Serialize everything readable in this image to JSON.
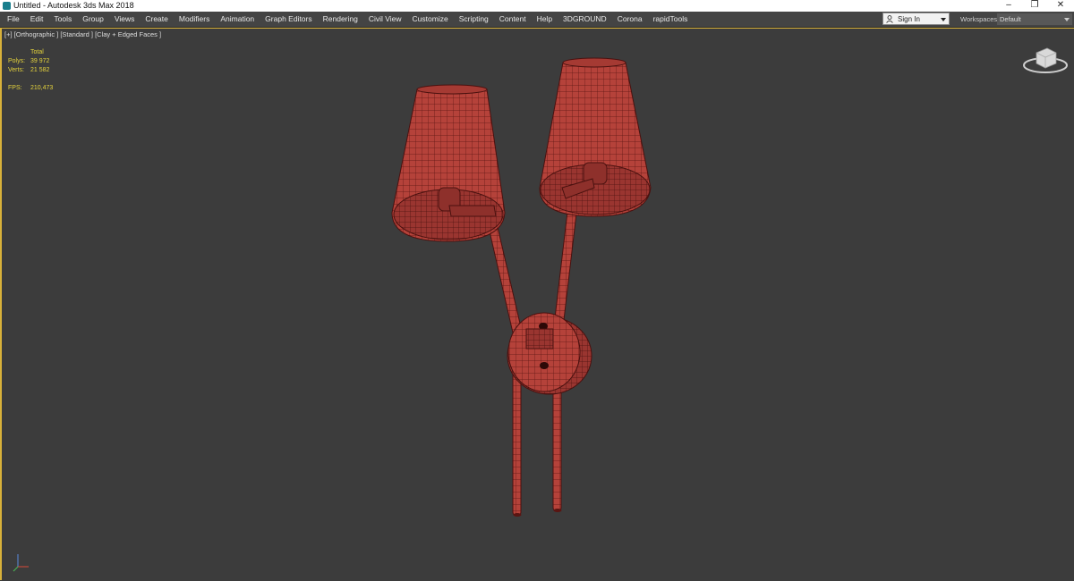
{
  "window": {
    "title": "Untitled - Autodesk 3ds Max 2018",
    "controls": [
      "–",
      "❐",
      "✕"
    ]
  },
  "menu": {
    "items": [
      "File",
      "Edit",
      "Tools",
      "Group",
      "Views",
      "Create",
      "Modifiers",
      "Animation",
      "Graph Editors",
      "Rendering",
      "Civil View",
      "Customize",
      "Scripting",
      "Content",
      "Help",
      "3DGROUND",
      "Corona",
      "rapidTools"
    ]
  },
  "account": {
    "sign_in_label": "Sign In",
    "icon": "user-icon"
  },
  "workspaces": {
    "label": "Workspaces:",
    "value": "Default"
  },
  "viewport": {
    "label": "[+] [Orthographic ] [Standard ] [Clay + Edged Faces ]",
    "stats": {
      "header": "Total",
      "polys_label": "Polys:",
      "polys_value": "39 972",
      "verts_label": "Verts:",
      "verts_value": "21 582",
      "fps_label": "FPS:",
      "fps_value": "210,473"
    },
    "active_border_color": "#d8b13a",
    "model_color": "#b8433c",
    "wire_color": "#5a1512"
  }
}
